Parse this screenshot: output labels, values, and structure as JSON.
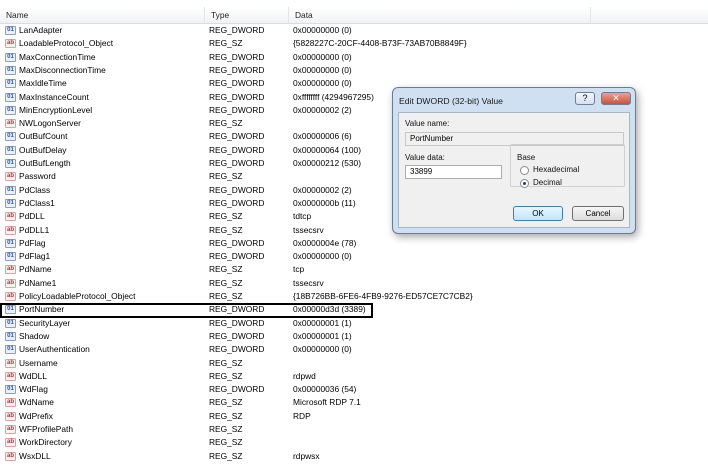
{
  "columns": {
    "name": "Name",
    "type": "Type",
    "data": "Data"
  },
  "rows": [
    {
      "name": "LanAdapter",
      "type": "REG_DWORD",
      "data": "0x00000000 (0)",
      "icon": "dword-value-icon"
    },
    {
      "name": "LoadableProtocol_Object",
      "type": "REG_SZ",
      "data": "{5828227C-20CF-4408-B73F-73AB70B8849F}",
      "icon": "string-value-icon"
    },
    {
      "name": "MaxConnectionTime",
      "type": "REG_DWORD",
      "data": "0x00000000 (0)",
      "icon": "dword-value-icon"
    },
    {
      "name": "MaxDisconnectionTime",
      "type": "REG_DWORD",
      "data": "0x00000000 (0)",
      "icon": "dword-value-icon"
    },
    {
      "name": "MaxIdleTime",
      "type": "REG_DWORD",
      "data": "0x00000000 (0)",
      "icon": "dword-value-icon"
    },
    {
      "name": "MaxInstanceCount",
      "type": "REG_DWORD",
      "data": "0xffffffff (4294967295)",
      "icon": "dword-value-icon"
    },
    {
      "name": "MinEncryptionLevel",
      "type": "REG_DWORD",
      "data": "0x00000002 (2)",
      "icon": "dword-value-icon"
    },
    {
      "name": "NWLogonServer",
      "type": "REG_SZ",
      "data": "",
      "icon": "string-value-icon"
    },
    {
      "name": "OutBufCount",
      "type": "REG_DWORD",
      "data": "0x00000006 (6)",
      "icon": "dword-value-icon"
    },
    {
      "name": "OutBufDelay",
      "type": "REG_DWORD",
      "data": "0x00000064 (100)",
      "icon": "dword-value-icon"
    },
    {
      "name": "OutBufLength",
      "type": "REG_DWORD",
      "data": "0x00000212 (530)",
      "icon": "dword-value-icon"
    },
    {
      "name": "Password",
      "type": "REG_SZ",
      "data": "",
      "icon": "string-value-icon"
    },
    {
      "name": "PdClass",
      "type": "REG_DWORD",
      "data": "0x00000002 (2)",
      "icon": "dword-value-icon"
    },
    {
      "name": "PdClass1",
      "type": "REG_DWORD",
      "data": "0x0000000b (11)",
      "icon": "dword-value-icon"
    },
    {
      "name": "PdDLL",
      "type": "REG_SZ",
      "data": "tdtcp",
      "icon": "string-value-icon"
    },
    {
      "name": "PdDLL1",
      "type": "REG_SZ",
      "data": "tssecsrv",
      "icon": "string-value-icon"
    },
    {
      "name": "PdFlag",
      "type": "REG_DWORD",
      "data": "0x0000004e (78)",
      "icon": "dword-value-icon"
    },
    {
      "name": "PdFlag1",
      "type": "REG_DWORD",
      "data": "0x00000000 (0)",
      "icon": "dword-value-icon"
    },
    {
      "name": "PdName",
      "type": "REG_SZ",
      "data": "tcp",
      "icon": "string-value-icon"
    },
    {
      "name": "PdName1",
      "type": "REG_SZ",
      "data": "tssecsrv",
      "icon": "string-value-icon"
    },
    {
      "name": "PolicyLoadableProtocol_Object",
      "type": "REG_SZ",
      "data": "{18B726BB-6FE6-4FB9-9276-ED57CE7C7CB2}",
      "icon": "string-value-icon"
    },
    {
      "name": "PortNumber",
      "type": "REG_DWORD",
      "data": "0x00000d3d (3389)",
      "icon": "dword-value-icon"
    },
    {
      "name": "SecurityLayer",
      "type": "REG_DWORD",
      "data": "0x00000001 (1)",
      "icon": "dword-value-icon"
    },
    {
      "name": "Shadow",
      "type": "REG_DWORD",
      "data": "0x00000001 (1)",
      "icon": "dword-value-icon"
    },
    {
      "name": "UserAuthentication",
      "type": "REG_DWORD",
      "data": "0x00000000 (0)",
      "icon": "dword-value-icon"
    },
    {
      "name": "Username",
      "type": "REG_SZ",
      "data": "",
      "icon": "string-value-icon"
    },
    {
      "name": "WdDLL",
      "type": "REG_SZ",
      "data": "rdpwd",
      "icon": "string-value-icon"
    },
    {
      "name": "WdFlag",
      "type": "REG_DWORD",
      "data": "0x00000036 (54)",
      "icon": "dword-value-icon"
    },
    {
      "name": "WdName",
      "type": "REG_SZ",
      "data": "Microsoft RDP 7.1",
      "icon": "string-value-icon"
    },
    {
      "name": "WdPrefix",
      "type": "REG_SZ",
      "data": "RDP",
      "icon": "string-value-icon"
    },
    {
      "name": "WFProfilePath",
      "type": "REG_SZ",
      "data": "",
      "icon": "string-value-icon"
    },
    {
      "name": "WorkDirectory",
      "type": "REG_SZ",
      "data": "",
      "icon": "string-value-icon"
    },
    {
      "name": "WsxDLL",
      "type": "REG_SZ",
      "data": "rdpwsx",
      "icon": "string-value-icon"
    }
  ],
  "highlighted_row": "PortNumber",
  "dialog": {
    "title": "Edit DWORD (32-bit) Value",
    "help_label": "?",
    "close_label": "✕",
    "value_name_label": "Value name:",
    "value_name": "PortNumber",
    "value_data_label": "Value data:",
    "value_data": "33899",
    "base_label": "Base",
    "hex_label": "Hexadecimal",
    "decimal_label": "Decimal",
    "selected_base": "Decimal",
    "ok_label": "OK",
    "cancel_label": "Cancel"
  }
}
